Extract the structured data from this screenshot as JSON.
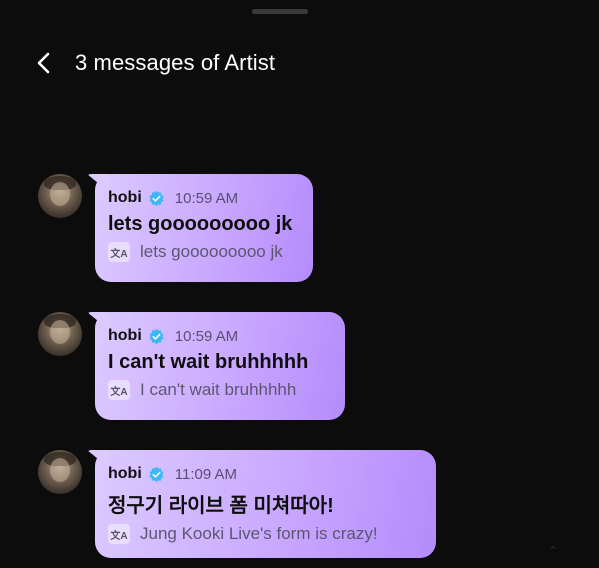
{
  "header": {
    "title": "3 messages of Artist"
  },
  "messages": [
    {
      "author": "hobi",
      "time": "10:59 AM",
      "text": "lets gooooooooo jk",
      "translation": "lets gooooooooo jk"
    },
    {
      "author": "hobi",
      "time": "10:59 AM",
      "text": "I can't wait bruhhhhh",
      "translation": "I can't wait bruhhhhh"
    },
    {
      "author": "hobi",
      "time": "11:09 AM",
      "text": "정구기 라이브 폼 미쳐따아!",
      "translation": "Jung Kooki Live's form is crazy!"
    }
  ],
  "icons": {
    "back": "chevron-left-icon",
    "verified": "verified-badge-icon",
    "translate": "translate-icon"
  },
  "colors": {
    "background": "#0c0c0d",
    "bubble": "#c9a8ff",
    "verified": "#3fb6f5"
  }
}
